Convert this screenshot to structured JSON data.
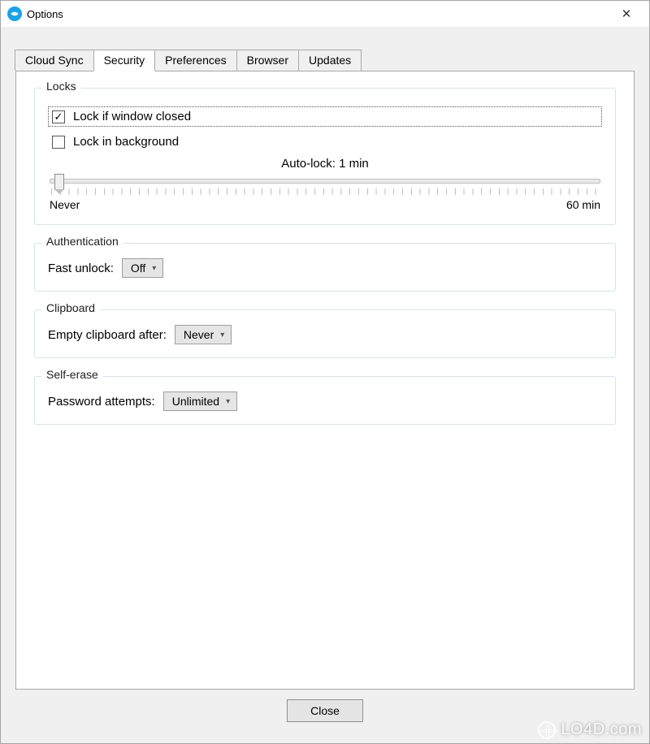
{
  "titlebar": {
    "title": "Options"
  },
  "tabs": [
    {
      "label": "Cloud Sync",
      "active": false
    },
    {
      "label": "Security",
      "active": true
    },
    {
      "label": "Preferences",
      "active": false
    },
    {
      "label": "Browser",
      "active": false
    },
    {
      "label": "Updates",
      "active": false
    }
  ],
  "locks": {
    "legend": "Locks",
    "check1_label": "Lock if window closed",
    "check1_checked": true,
    "check2_label": "Lock in background",
    "check2_checked": false,
    "autolock_label": "Auto-lock: 1 min",
    "min_label": "Never",
    "max_label": "60 min",
    "value_percent": 1.6
  },
  "authentication": {
    "legend": "Authentication",
    "label": "Fast unlock:",
    "value": "Off"
  },
  "clipboard": {
    "legend": "Clipboard",
    "label": "Empty clipboard after:",
    "value": "Never"
  },
  "self_erase": {
    "legend": "Self-erase",
    "label": "Password attempts:",
    "value": "Unlimited"
  },
  "footer": {
    "close": "Close"
  },
  "watermark": "LO4D.com"
}
